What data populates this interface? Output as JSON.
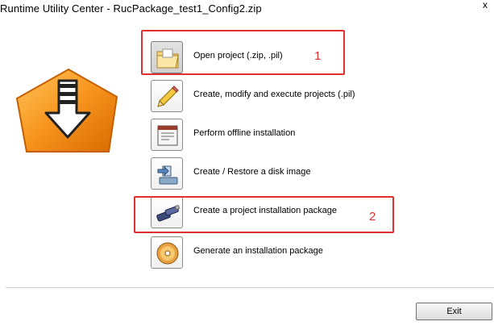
{
  "window": {
    "title": "Runtime Utility Center - RucPackage_test1_Config2.zip",
    "close_glyph": "x"
  },
  "menu": {
    "items": [
      {
        "label": "Open project (.zip, .pil)",
        "icon": "folder-icon"
      },
      {
        "label": "Create, modify and execute projects (.pil)",
        "icon": "pencil-icon"
      },
      {
        "label": "Perform offline installation",
        "icon": "installer-window-icon"
      },
      {
        "label": "Create / Restore a disk image",
        "icon": "disk-image-icon"
      },
      {
        "label": "Create a project installation package",
        "icon": "usb-drive-icon"
      },
      {
        "label": "Generate an installation package",
        "icon": "cd-disc-icon"
      }
    ]
  },
  "annotations": [
    {
      "number": "1",
      "color": "#e03030"
    },
    {
      "number": "2",
      "color": "#e03030"
    }
  ],
  "footer": {
    "exit_label": "Exit"
  },
  "colors": {
    "logo_orange": "#f7941d",
    "annotation_red": "#e03030"
  }
}
